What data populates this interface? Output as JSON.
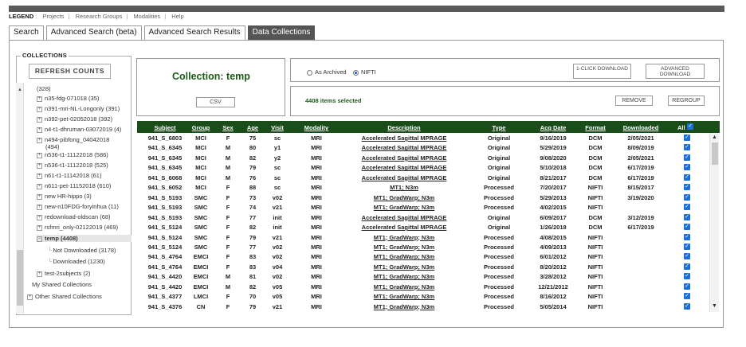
{
  "legend": {
    "label": "LEGEND",
    "links": [
      "Projects",
      "Research Groups",
      "Modalities",
      "Help"
    ]
  },
  "tabs": [
    "Search",
    "Advanced Search (beta)",
    "Advanced Search Results",
    "Data Collections"
  ],
  "active_tab": "Data Collections",
  "collections": {
    "title": "COLLECTIONS",
    "refresh_label": "REFRESH COUNTS",
    "items": [
      {
        "label": "(328)",
        "expander": ""
      },
      {
        "label": "n35-fdg-071018 (35)",
        "expander": "+"
      },
      {
        "label": "n391-mri-NL-Longonly (391)",
        "expander": "+"
      },
      {
        "label": "n392-pet-02052018 (392)",
        "expander": "+"
      },
      {
        "label": "n4-t1-dhruman-03072019 (4)",
        "expander": "+"
      },
      {
        "label": "n494-pibfong_04042018",
        "label2": "(494)",
        "expander": "+"
      },
      {
        "label": "n536-t1-11122018 (586)",
        "expander": "+"
      },
      {
        "label": "n536-t1-11122018 (525)",
        "expander": "+"
      },
      {
        "label": "n61-t1-11142018 (61)",
        "expander": "+"
      },
      {
        "label": "n611-pet-11152018 (610)",
        "expander": "+"
      },
      {
        "label": "new HR-hippo (3)",
        "expander": "+"
      },
      {
        "label": "new-n10FDG-foryinhua (11)",
        "expander": "+"
      },
      {
        "label": "redownload-oldscan (68)",
        "expander": "+"
      },
      {
        "label": "rsfmri_only-02122019 (469)",
        "expander": "+"
      },
      {
        "label": "temp (4408)",
        "expander": "−"
      },
      {
        "label": "Not Downloaded (3178)",
        "expander": ""
      },
      {
        "label": "Downloaded (1230)",
        "expander": ""
      },
      {
        "label": "test-2subjects (2)",
        "expander": "+"
      },
      {
        "label": "My Shared Collections",
        "expander": ""
      },
      {
        "label": "Other Shared Collections",
        "expander": "+"
      }
    ]
  },
  "collection": {
    "title": "Collection: temp",
    "csv_label": "CSV"
  },
  "options": {
    "as_archived": "As Archived",
    "nifti": "NIFTI",
    "selected": "NIFTI",
    "one_click_download": "1-CLICK DOWNLOAD",
    "advanced_download": "ADVANCED DOWNLOAD",
    "items_selected": "4408 items selected",
    "remove": "REMOVE",
    "regroup": "REGROUP"
  },
  "table": {
    "columns": [
      "Subject",
      "Group",
      "Sex",
      "Age",
      "Visit",
      "Modality",
      "Description",
      "Type",
      "Acq Date",
      "Format",
      "Downloaded"
    ],
    "all_label": "All",
    "rows": [
      [
        "941_S_6803",
        "MCI",
        "F",
        "75",
        "sc",
        "MRI",
        "Accelerated Sagittal MPRAGE",
        "Original",
        "9/16/2019",
        "DCM",
        "2/05/2021"
      ],
      [
        "941_S_6345",
        "MCI",
        "M",
        "80",
        "y1",
        "MRI",
        "Accelerated Sagittal MPRAGE",
        "Original",
        "5/29/2019",
        "DCM",
        "8/09/2019"
      ],
      [
        "941_S_6345",
        "MCI",
        "M",
        "82",
        "y2",
        "MRI",
        "Accelerated Sagittal MPRAGE",
        "Original",
        "9/08/2020",
        "DCM",
        "2/05/2021"
      ],
      [
        "941_S_6345",
        "MCI",
        "M",
        "79",
        "sc",
        "MRI",
        "Accelerated Sagittal MPRAGE",
        "Original",
        "5/10/2018",
        "DCM",
        "6/17/2019"
      ],
      [
        "941_S_6068",
        "MCI",
        "M",
        "76",
        "sc",
        "MRI",
        "Accelerated Sagittal MPRAGE",
        "Original",
        "8/21/2017",
        "DCM",
        "6/17/2019"
      ],
      [
        "941_S_6052",
        "MCI",
        "F",
        "88",
        "sc",
        "MRI",
        "MT1; N3m",
        "Processed",
        "7/20/2017",
        "NIFTI",
        "8/15/2017"
      ],
      [
        "941_S_5193",
        "SMC",
        "F",
        "73",
        "v02",
        "MRI",
        "MT1; GradWarp; N3m",
        "Processed",
        "5/29/2013",
        "NIFTI",
        "3/19/2020"
      ],
      [
        "941_S_5193",
        "SMC",
        "F",
        "74",
        "v21",
        "MRI",
        "MT1; GradWarp; N3m",
        "Processed",
        "4/02/2015",
        "NIFTI",
        ""
      ],
      [
        "941_S_5193",
        "SMC",
        "F",
        "77",
        "init",
        "MRI",
        "Accelerated Sagittal MPRAGE",
        "Original",
        "6/09/2017",
        "DCM",
        "3/12/2019"
      ],
      [
        "941_S_5124",
        "SMC",
        "F",
        "82",
        "init",
        "MRI",
        "Accelerated Sagittal MPRAGE",
        "Original",
        "1/26/2018",
        "DCM",
        "6/17/2019"
      ],
      [
        "941_S_5124",
        "SMC",
        "F",
        "79",
        "v21",
        "MRI",
        "MT1; GradWarp; N3m",
        "Processed",
        "4/08/2015",
        "NIFTI",
        ""
      ],
      [
        "941_S_5124",
        "SMC",
        "F",
        "77",
        "v02",
        "MRI",
        "MT1; GradWarp; N3m",
        "Processed",
        "4/09/2013",
        "NIFTI",
        ""
      ],
      [
        "941_S_4764",
        "EMCI",
        "F",
        "83",
        "v02",
        "MRI",
        "MT1; GradWarp; N3m",
        "Processed",
        "6/01/2012",
        "NIFTI",
        ""
      ],
      [
        "941_S_4764",
        "EMCI",
        "F",
        "83",
        "v04",
        "MRI",
        "MT1; GradWarp; N3m",
        "Processed",
        "8/20/2012",
        "NIFTI",
        ""
      ],
      [
        "941_S_4420",
        "EMCI",
        "M",
        "81",
        "v02",
        "MRI",
        "MT1; GradWarp; N3m",
        "Processed",
        "3/28/2012",
        "NIFTI",
        ""
      ],
      [
        "941_S_4420",
        "EMCI",
        "M",
        "82",
        "v05",
        "MRI",
        "MT1; GradWarp; N3m",
        "Processed",
        "12/21/2012",
        "NIFTI",
        ""
      ],
      [
        "941_S_4377",
        "LMCI",
        "F",
        "70",
        "v05",
        "MRI",
        "MT1; GradWarp; N3m",
        "Processed",
        "8/16/2012",
        "NIFTI",
        ""
      ],
      [
        "941_S_4376",
        "CN",
        "F",
        "79",
        "v21",
        "MRI",
        "MT1; GradWarp; N3m",
        "Processed",
        "5/05/2014",
        "NIFTI",
        ""
      ]
    ]
  }
}
